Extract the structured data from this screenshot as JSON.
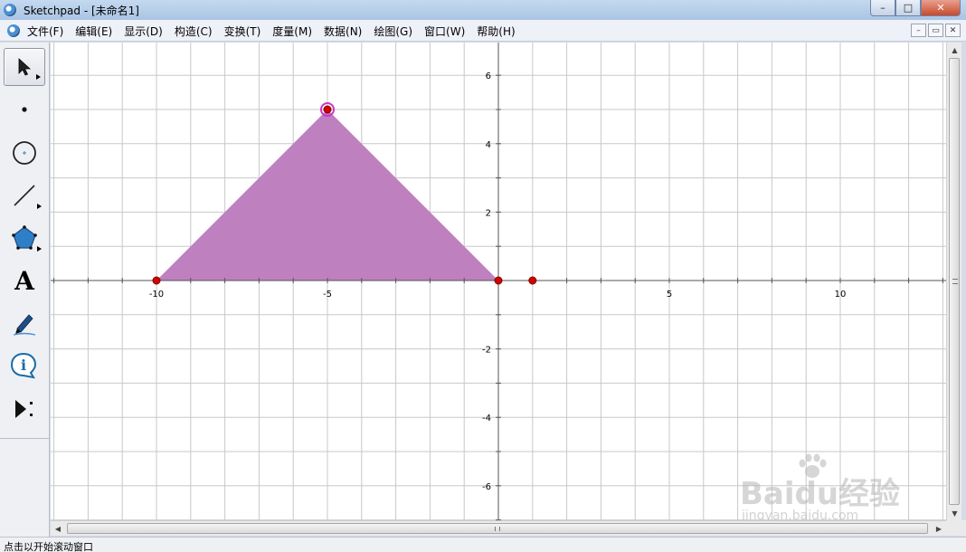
{
  "window": {
    "title": "Sketchpad  - [未命名1]",
    "buttons": {
      "minimize": "–",
      "maximize": "□",
      "close": "✕"
    }
  },
  "menubar": {
    "items": [
      {
        "label": "文件(F)"
      },
      {
        "label": "编辑(E)"
      },
      {
        "label": "显示(D)"
      },
      {
        "label": "构造(C)"
      },
      {
        "label": "变换(T)"
      },
      {
        "label": "度量(M)"
      },
      {
        "label": "数据(N)"
      },
      {
        "label": "绘图(G)"
      },
      {
        "label": "窗口(W)"
      },
      {
        "label": "帮助(H)"
      }
    ],
    "mdi_buttons": {
      "minimize": "–",
      "restore": "▭",
      "close": "✕"
    }
  },
  "toolbox": {
    "tools": [
      {
        "name": "selection-arrow-tool",
        "icon": "arrow-icon",
        "active": true
      },
      {
        "name": "point-tool",
        "icon": "point-icon"
      },
      {
        "name": "compass-tool",
        "icon": "circle-icon"
      },
      {
        "name": "straightedge-tool",
        "icon": "segment-icon"
      },
      {
        "name": "polygon-tool",
        "icon": "polygon-icon"
      },
      {
        "name": "text-tool",
        "icon": "text-icon",
        "glyph": "A"
      },
      {
        "name": "marker-tool",
        "icon": "marker-icon"
      },
      {
        "name": "information-tool",
        "icon": "info-icon",
        "glyph": "i"
      },
      {
        "name": "custom-tool",
        "icon": "custom-tool-icon"
      }
    ]
  },
  "graph": {
    "x_tick_labels": [
      "-10",
      "-5",
      "5",
      "10"
    ],
    "y_tick_labels": [
      "6",
      "4",
      "2",
      "-2",
      "-4",
      "-6"
    ],
    "grid": true,
    "colors": {
      "polygon_fill": "#bf80bf",
      "point": "#d40000",
      "grid": "#c8c8c8",
      "axis": "#555555",
      "selected_ring": "#cc33cc"
    }
  },
  "chart_data": {
    "type": "scatter",
    "grid": true,
    "x_ticks": [
      -10,
      -5,
      5,
      10
    ],
    "y_ticks": [
      -6,
      -4,
      -2,
      2,
      4,
      6
    ],
    "polygon": [
      [
        -10,
        0
      ],
      [
        -5,
        5
      ],
      [
        0,
        0
      ]
    ],
    "points": [
      {
        "x": -10,
        "y": 0
      },
      {
        "x": -5,
        "y": 5,
        "selected": true
      },
      {
        "x": 0,
        "y": 0
      },
      {
        "x": 1,
        "y": 0
      }
    ]
  },
  "statusbar": {
    "text": "点击以开始滚动窗口"
  },
  "watermark": {
    "main": "Baidu经验",
    "sub": "jingyan.baidu.com"
  }
}
